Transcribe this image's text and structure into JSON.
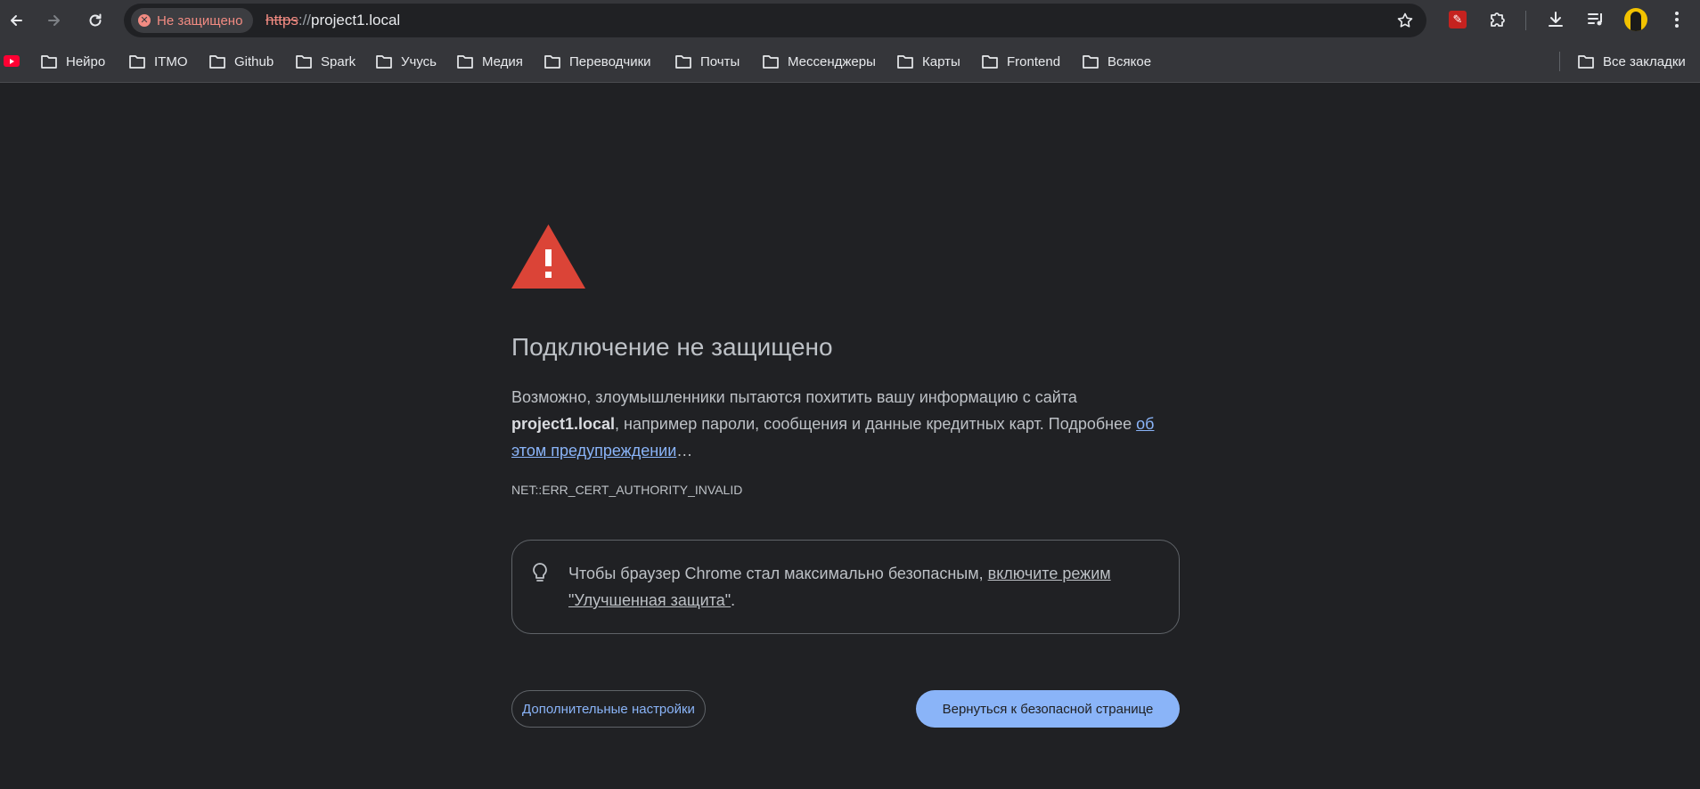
{
  "browser": {
    "security_chip": "Не защищено",
    "url_scheme": "https",
    "url_separator": "://",
    "url_host": "project1.local",
    "icons": [
      "back-icon",
      "forward-icon",
      "reload-icon",
      "star-icon",
      "extension-icon",
      "puzzle-icon",
      "download-icon",
      "media-icon",
      "avatar",
      "more-icon"
    ]
  },
  "bookmarks": {
    "items": [
      "Нейро",
      "ITMO",
      "Github",
      "Spark",
      "Учусь",
      "Медия",
      "Переводчики",
      "Почты",
      "Мессенджеры",
      "Карты",
      "Frontend",
      "Всякое"
    ],
    "all": "Все закладки"
  },
  "interstitial": {
    "title": "Подключение не защищено",
    "desc_part1": "Возможно, злоумышленники пытаются похитить вашу информацию с сайта ",
    "desc_host": "project1.local",
    "desc_part2": ", например пароли, сообщения и данные кредитных карт. Подробнее ",
    "desc_link": "об этом предупреждении",
    "desc_ellipsis": "…",
    "error_code": "NET::ERR_CERT_AUTHORITY_INVALID",
    "tip_text": "Чтобы браузер Chrome стал максимально безопасным, ",
    "tip_link": "включите режим \"Улучшенная защита\"",
    "tip_end": ".",
    "advanced_button": "Дополнительные настройки",
    "back_button": "Вернуться к безопасной странице"
  },
  "colors": {
    "background": "#202124",
    "toolbar": "#35363a",
    "danger": "#f28b82",
    "warning_icon": "#db4437",
    "link": "#8ab4f8",
    "primary_button": "#8ab4f8"
  }
}
